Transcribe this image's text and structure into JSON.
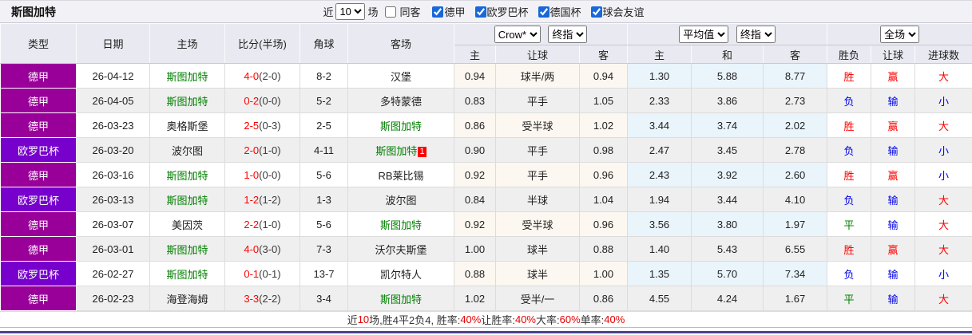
{
  "header": {
    "team_title": "斯图加特",
    "filters": {
      "recent_label": "近",
      "recent_value": "10",
      "games_label": "场",
      "same_away_label": "同客",
      "same_away_checked": false,
      "leagues": [
        {
          "label": "德甲",
          "checked": true
        },
        {
          "label": "欧罗巴杯",
          "checked": true
        },
        {
          "label": "德国杯",
          "checked": true
        },
        {
          "label": "球会友谊",
          "checked": true
        }
      ]
    },
    "selects": {
      "bookmaker": "Crow*",
      "bookmaker_stage": "终指",
      "average": "平均值",
      "average_stage": "终指",
      "scope": "全场"
    }
  },
  "table": {
    "columns": [
      "类型",
      "日期",
      "主场",
      "比分(半场)",
      "角球",
      "客场",
      "主",
      "让球",
      "客",
      "主",
      "和",
      "客",
      "胜负",
      "让球",
      "进球数"
    ],
    "rows": [
      {
        "type": "德甲",
        "date": "26-04-12",
        "home": "斯图加特",
        "home_target": true,
        "score": "4-0",
        "half": "(2-0)",
        "corner": "8-2",
        "away": "汉堡",
        "away_target": false,
        "away_badge": "",
        "odds_home": "0.94",
        "handicap": "球半/两",
        "odds_away": "0.94",
        "avg_home": "1.30",
        "avg_draw": "5.88",
        "avg_away": "8.77",
        "res_wdl": "胜",
        "res_handicap": "赢",
        "res_goals": "大"
      },
      {
        "type": "德甲",
        "date": "26-04-05",
        "home": "斯图加特",
        "home_target": true,
        "score": "0-2",
        "half": "(0-0)",
        "corner": "5-2",
        "away": "多特蒙德",
        "away_target": false,
        "away_badge": "",
        "odds_home": "0.83",
        "handicap": "平手",
        "odds_away": "1.05",
        "avg_home": "2.33",
        "avg_draw": "3.86",
        "avg_away": "2.73",
        "res_wdl": "负",
        "res_handicap": "输",
        "res_goals": "小"
      },
      {
        "type": "德甲",
        "date": "26-03-23",
        "home": "奥格斯堡",
        "home_target": false,
        "score": "2-5",
        "half": "(0-3)",
        "corner": "2-5",
        "away": "斯图加特",
        "away_target": true,
        "away_badge": "",
        "odds_home": "0.86",
        "handicap": "受半球",
        "odds_away": "1.02",
        "avg_home": "3.44",
        "avg_draw": "3.74",
        "avg_away": "2.02",
        "res_wdl": "胜",
        "res_handicap": "赢",
        "res_goals": "大"
      },
      {
        "type": "欧罗巴杯",
        "date": "26-03-20",
        "home": "波尔图",
        "home_target": false,
        "score": "2-0",
        "half": "(1-0)",
        "corner": "4-11",
        "away": "斯图加特",
        "away_target": true,
        "away_badge": "1",
        "odds_home": "0.90",
        "handicap": "平手",
        "odds_away": "0.98",
        "avg_home": "2.47",
        "avg_draw": "3.45",
        "avg_away": "2.78",
        "res_wdl": "负",
        "res_handicap": "输",
        "res_goals": "小"
      },
      {
        "type": "德甲",
        "date": "26-03-16",
        "home": "斯图加特",
        "home_target": true,
        "score": "1-0",
        "half": "(0-0)",
        "corner": "5-6",
        "away": "RB莱比锡",
        "away_target": false,
        "away_badge": "",
        "odds_home": "0.92",
        "handicap": "平手",
        "odds_away": "0.96",
        "avg_home": "2.43",
        "avg_draw": "3.92",
        "avg_away": "2.60",
        "res_wdl": "胜",
        "res_handicap": "赢",
        "res_goals": "小"
      },
      {
        "type": "欧罗巴杯",
        "date": "26-03-13",
        "home": "斯图加特",
        "home_target": true,
        "score": "1-2",
        "half": "(1-2)",
        "corner": "1-3",
        "away": "波尔图",
        "away_target": false,
        "away_badge": "",
        "odds_home": "0.84",
        "handicap": "半球",
        "odds_away": "1.04",
        "avg_home": "1.94",
        "avg_draw": "3.44",
        "avg_away": "4.10",
        "res_wdl": "负",
        "res_handicap": "输",
        "res_goals": "大"
      },
      {
        "type": "德甲",
        "date": "26-03-07",
        "home": "美因茨",
        "home_target": false,
        "score": "2-2",
        "half": "(1-0)",
        "corner": "5-6",
        "away": "斯图加特",
        "away_target": true,
        "away_badge": "",
        "odds_home": "0.92",
        "handicap": "受半球",
        "odds_away": "0.96",
        "avg_home": "3.56",
        "avg_draw": "3.80",
        "avg_away": "1.97",
        "res_wdl": "平",
        "res_handicap": "输",
        "res_goals": "大"
      },
      {
        "type": "德甲",
        "date": "26-03-01",
        "home": "斯图加特",
        "home_target": true,
        "score": "4-0",
        "half": "(3-0)",
        "corner": "7-3",
        "away": "沃尔夫斯堡",
        "away_target": false,
        "away_badge": "",
        "odds_home": "1.00",
        "handicap": "球半",
        "odds_away": "0.88",
        "avg_home": "1.40",
        "avg_draw": "5.43",
        "avg_away": "6.55",
        "res_wdl": "胜",
        "res_handicap": "赢",
        "res_goals": "大"
      },
      {
        "type": "欧罗巴杯",
        "date": "26-02-27",
        "home": "斯图加特",
        "home_target": true,
        "score": "0-1",
        "half": "(0-1)",
        "corner": "13-7",
        "away": "凯尔特人",
        "away_target": false,
        "away_badge": "",
        "odds_home": "0.88",
        "handicap": "球半",
        "odds_away": "1.00",
        "avg_home": "1.35",
        "avg_draw": "5.70",
        "avg_away": "7.34",
        "res_wdl": "负",
        "res_handicap": "输",
        "res_goals": "小"
      },
      {
        "type": "德甲",
        "date": "26-02-23",
        "home": "海登海姆",
        "home_target": false,
        "score": "3-3",
        "half": "(2-2)",
        "corner": "3-4",
        "away": "斯图加特",
        "away_target": true,
        "away_badge": "",
        "odds_home": "1.02",
        "handicap": "受半/一",
        "odds_away": "0.86",
        "avg_home": "4.55",
        "avg_draw": "4.24",
        "avg_away": "1.67",
        "res_wdl": "平",
        "res_handicap": "输",
        "res_goals": "大"
      }
    ]
  },
  "footer": {
    "parts": [
      {
        "text": "近",
        "red": false
      },
      {
        "text": "10",
        "red": true
      },
      {
        "text": "场,胜4平2负4, 胜率:",
        "red": false
      },
      {
        "text": "40%",
        "red": true
      },
      {
        "text": " 让胜率:",
        "red": false
      },
      {
        "text": "40%",
        "red": true
      },
      {
        "text": " 大率:",
        "red": false
      },
      {
        "text": "60%",
        "red": true
      },
      {
        "text": " 单率:",
        "red": false
      },
      {
        "text": "40%",
        "red": true
      }
    ]
  },
  "colors": {
    "league": {
      "德甲": "#990099",
      "欧罗巴杯": "#7700cc"
    },
    "result": {
      "胜": "#ff0000",
      "赢": "#ff0000",
      "大": "#ff0000",
      "负": "#0000ee",
      "输": "#0000ee",
      "小": "#0000ee",
      "平": "#008000"
    },
    "summary_red": "#e60000",
    "summary_text": "#333333"
  }
}
